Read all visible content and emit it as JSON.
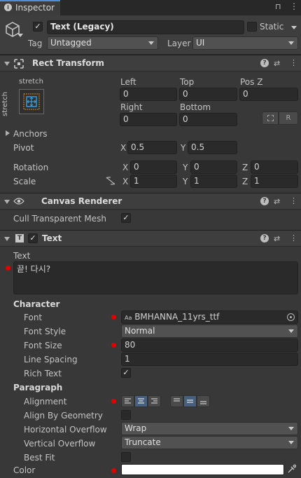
{
  "tab": {
    "label": "Inspector"
  },
  "object": {
    "name": "Text (Legacy)",
    "static_label": "Static",
    "tag_label": "Tag",
    "tag_value": "Untagged",
    "layer_label": "Layer",
    "layer_value": "UI"
  },
  "rect_transform": {
    "title": "Rect Transform",
    "anchor_top": "stretch",
    "anchor_side": "stretch",
    "left_label": "Left",
    "left_value": "0",
    "top_label": "Top",
    "top_value": "0",
    "posz_label": "Pos Z",
    "posz_value": "0",
    "right_label": "Right",
    "right_value": "0",
    "bottom_label": "Bottom",
    "bottom_value": "0",
    "r_button": "R",
    "anchors_label": "Anchors",
    "pivot_label": "Pivot",
    "pivot_x": "0.5",
    "pivot_y": "0.5",
    "rotation_label": "Rotation",
    "rot_x": "0",
    "rot_y": "0",
    "rot_z": "0",
    "scale_label": "Scale",
    "scale_x": "1",
    "scale_y": "1",
    "scale_z": "1",
    "x": "X",
    "y": "Y",
    "z": "Z"
  },
  "canvas_renderer": {
    "title": "Canvas Renderer",
    "cull_label": "Cull Transparent Mesh",
    "cull_checked": "✓"
  },
  "text_component": {
    "title": "Text",
    "text_label": "Text",
    "text_value": "끝! 다시?",
    "character_label": "Character",
    "font_label": "Font",
    "font_prefix": "Aa",
    "font_value": "BMHANNA_11yrs_ttf",
    "font_style_label": "Font Style",
    "font_style_value": "Normal",
    "font_size_label": "Font Size",
    "font_size_value": "80",
    "line_spacing_label": "Line Spacing",
    "line_spacing_value": "1",
    "rich_text_label": "Rich Text",
    "rich_text_checked": "✓",
    "paragraph_label": "Paragraph",
    "alignment_label": "Alignment",
    "align_by_geometry_label": "Align By Geometry",
    "horizontal_overflow_label": "Horizontal Overflow",
    "horizontal_overflow_value": "Wrap",
    "vertical_overflow_label": "Vertical Overflow",
    "vertical_overflow_value": "Truncate",
    "best_fit_label": "Best Fit",
    "color_label": "Color",
    "color_value": "#FFFFFF"
  },
  "colors": {
    "accent": "#3a72b0",
    "modified_dot": "#e00000",
    "panel": "#383838",
    "field": "#2a2a2a"
  }
}
